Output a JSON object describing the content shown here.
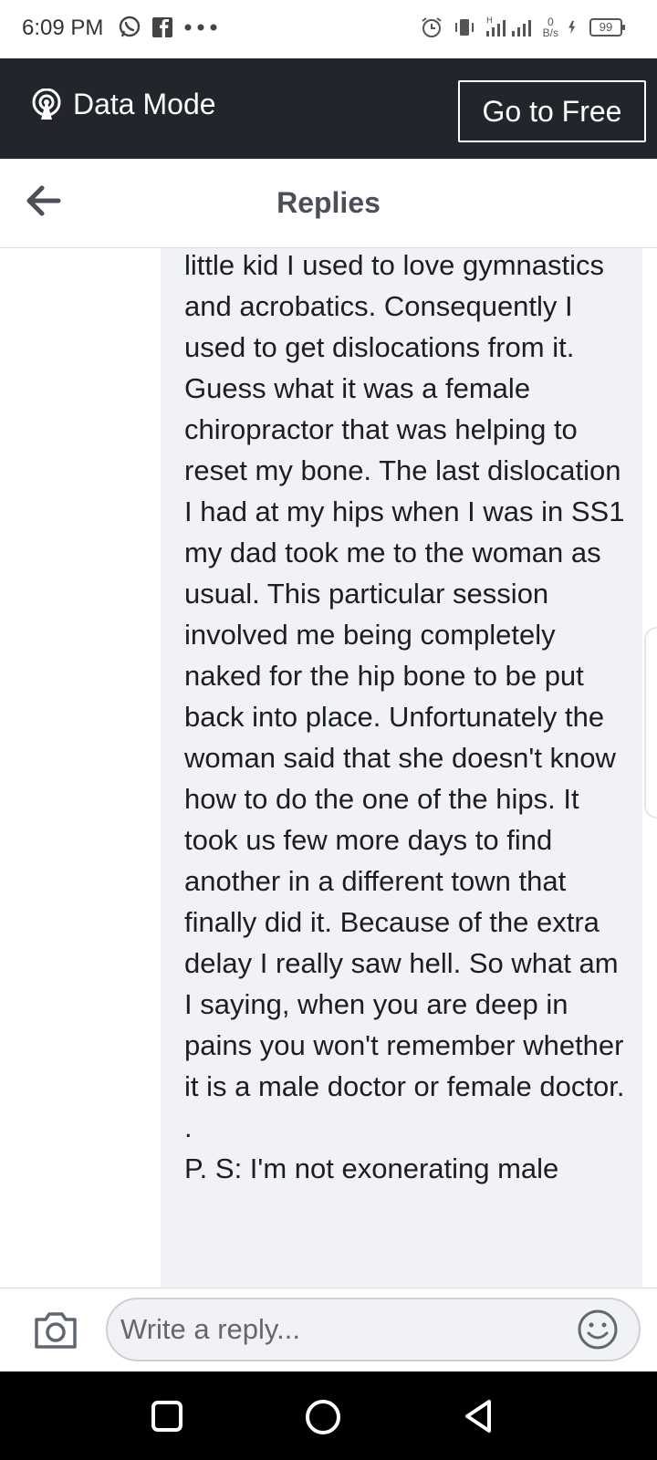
{
  "status_bar": {
    "time": "6:09 PM",
    "net_speed_value": "0",
    "net_speed_unit": "B/s",
    "battery": "99"
  },
  "data_bar": {
    "mode_label": "Data Mode",
    "go_free_label": "Go to Free"
  },
  "header": {
    "title": "Replies"
  },
  "reply": {
    "text": "little kid I used to love gymnastics and acrobatics. Consequently I used to get dislocations from it. Guess what it was a female chiropractor that was helping to reset my bone. The last dislocation I had at my hips when I was in SS1 my dad took me to the woman as usual. This particular session involved me being completely naked for the hip bone to be put back into place. Unfortunately the woman said that she doesn't know how to do the one of the hips. It took us few more days to find another in a different town that finally did it. Because of the extra delay I really saw hell. So what am I saying, when you are deep in pains you won't remember whether it is a male doctor or female doctor.\n.\nP. S: I'm not exonerating male"
  },
  "composer": {
    "placeholder": "Write a reply..."
  },
  "colors": {
    "data_bar_bg": "#22262c",
    "bubble_bg": "#f0f2f5",
    "header_title": "#4b4f56"
  }
}
